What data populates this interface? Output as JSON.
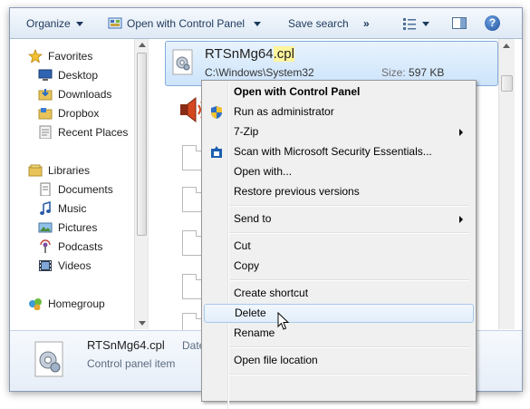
{
  "toolbar": {
    "organize": "Organize",
    "open_with": "Open with Control Panel",
    "save_search": "Save search",
    "more": "»",
    "help": "?"
  },
  "nav": {
    "favorites_header": "Favorites",
    "favorites": [
      "Desktop",
      "Downloads",
      "Dropbox",
      "Recent Places"
    ],
    "libraries_header": "Libraries",
    "libraries": [
      "Documents",
      "Music",
      "Pictures",
      "Podcasts",
      "Videos"
    ],
    "homegroup": "Homegroup"
  },
  "selected_file": {
    "name_base": "RTSnMg64",
    "name_ext": ".cpl",
    "path": "C:\\Windows\\System32",
    "size_label": "Size:",
    "size_value": "597 KB"
  },
  "details": {
    "name": "RTSnMg64.cpl",
    "type": "Control panel item",
    "date_partial": "Date"
  },
  "context_menu": {
    "items": [
      "Open with Control Panel",
      "Run as administrator",
      "7-Zip",
      "Scan with Microsoft Security Essentials...",
      "Open with...",
      "Restore previous versions",
      "Send to",
      "Cut",
      "Copy",
      "Create shortcut",
      "Delete",
      "Rename",
      "Open file location"
    ],
    "highlighted": "Delete"
  },
  "colors": {
    "selection_fill": "#cde4fb",
    "selection_border": "#84acdd",
    "ext_highlight": "#fff59d",
    "toolbar_text": "#1e395b"
  }
}
